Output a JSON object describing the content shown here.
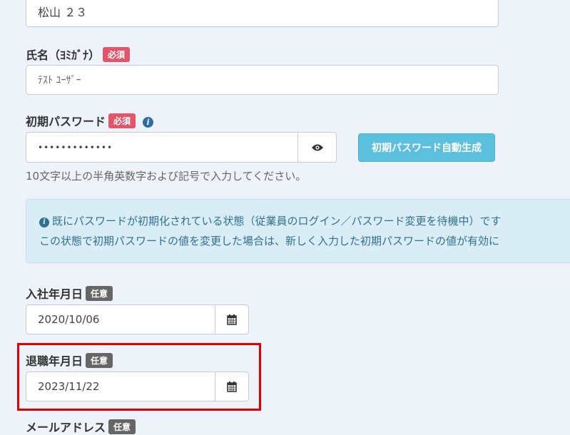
{
  "fields": {
    "prev_name_value": "松山  ２３",
    "kana": {
      "label": "氏名（ﾖﾐｶﾞﾅ）",
      "badge": "必須",
      "value": "ﾃｽﾄ ﾕｰｻﾞｰ"
    },
    "password": {
      "label": "初期パスワード",
      "badge": "必須",
      "value": "•••••••••••••",
      "generate_label": "初期パスワード自動生成",
      "help": "10文字以上の半角英数字および記号で入力してください。"
    },
    "alert": {
      "line1": "既にパスワードが初期化されている状態（従業員のログイン／パスワード変更を待機中）です",
      "line2": "この状態で初期パスワードの値を変更した場合は、新しく入力した初期パスワードの値が有効に"
    },
    "join_date": {
      "label": "入社年月日",
      "badge": "任意",
      "value": "2020/10/06"
    },
    "leave_date": {
      "label": "退職年月日",
      "badge": "任意",
      "value": "2023/11/22"
    },
    "email": {
      "label": "メールアドレス",
      "badge": "任意"
    }
  },
  "colors": {
    "required_badge": "#e2566a",
    "optional_badge": "#666666",
    "generate_button": "#5bc0de",
    "alert_bg": "#d9edf7",
    "highlight_border": "#e00000"
  },
  "icons": {
    "info": "info-circle-icon",
    "eye": "eye-icon",
    "calendar": "calendar-icon"
  }
}
